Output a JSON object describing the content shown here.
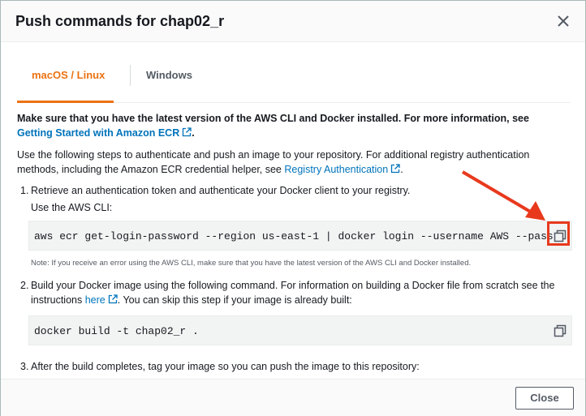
{
  "dialog": {
    "title": "Push commands for chap02_r",
    "close_label": "Close"
  },
  "tabs": [
    {
      "label": "macOS / Linux",
      "active": true
    },
    {
      "label": "Windows",
      "active": false
    }
  ],
  "intro": {
    "bold_text": "Make sure that you have the latest version of the AWS CLI and Docker installed. For more information, see ",
    "bold_link": "Getting Started with Amazon ECR",
    "bold_end": ".",
    "text": "Use the following steps to authenticate and push an image to your repository. For additional registry authentication methods, including the Amazon ECR credential helper, see ",
    "link": "Registry Authentication",
    "end": "."
  },
  "steps": [
    {
      "number": "1.",
      "text": "Retrieve an authentication token and authenticate your Docker client to your registry.",
      "subtext": "Use the AWS CLI:",
      "command": "aws ecr get-login-password --region us-east-1 | docker login --username AWS --password-stdin",
      "note": "Note: If you receive an error using the AWS CLI, make sure that you have the latest version of the AWS CLI and Docker installed."
    },
    {
      "number": "2.",
      "text_a": "Build your Docker image using the following command. For information on building a Docker file from scratch see the instructions ",
      "link": "here",
      "text_b": ". You can skip this step if your image is already built:",
      "command": "docker build -t chap02_r ."
    },
    {
      "number": "3.",
      "text": "After the build completes, tag your image so you can push the image to this repository:"
    }
  ],
  "colors": {
    "accent": "#ec7211",
    "link": "#0073bb",
    "annotation": "#e8391d"
  },
  "icons": [
    "close-icon",
    "external-link-icon",
    "copy-icon"
  ]
}
